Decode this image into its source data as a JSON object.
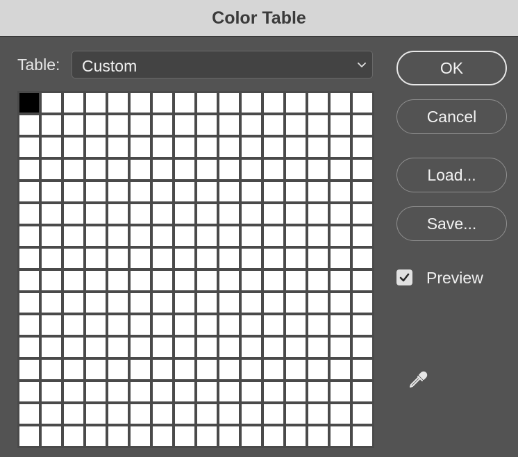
{
  "dialog": {
    "title": "Color Table"
  },
  "table": {
    "label": "Table:",
    "selected": "Custom"
  },
  "swatches": {
    "columns": 16,
    "rows": 16,
    "colors": [
      "#000000",
      "#ffffff"
    ],
    "first_color": "#000000",
    "default_color": "#ffffff"
  },
  "buttons": {
    "ok": "OK",
    "cancel": "Cancel",
    "load": "Load...",
    "save": "Save..."
  },
  "preview": {
    "label": "Preview",
    "checked": true
  },
  "icons": {
    "eyedropper": "eyedropper-icon",
    "chevron": "chevron-down-icon",
    "check": "checkmark-icon"
  }
}
